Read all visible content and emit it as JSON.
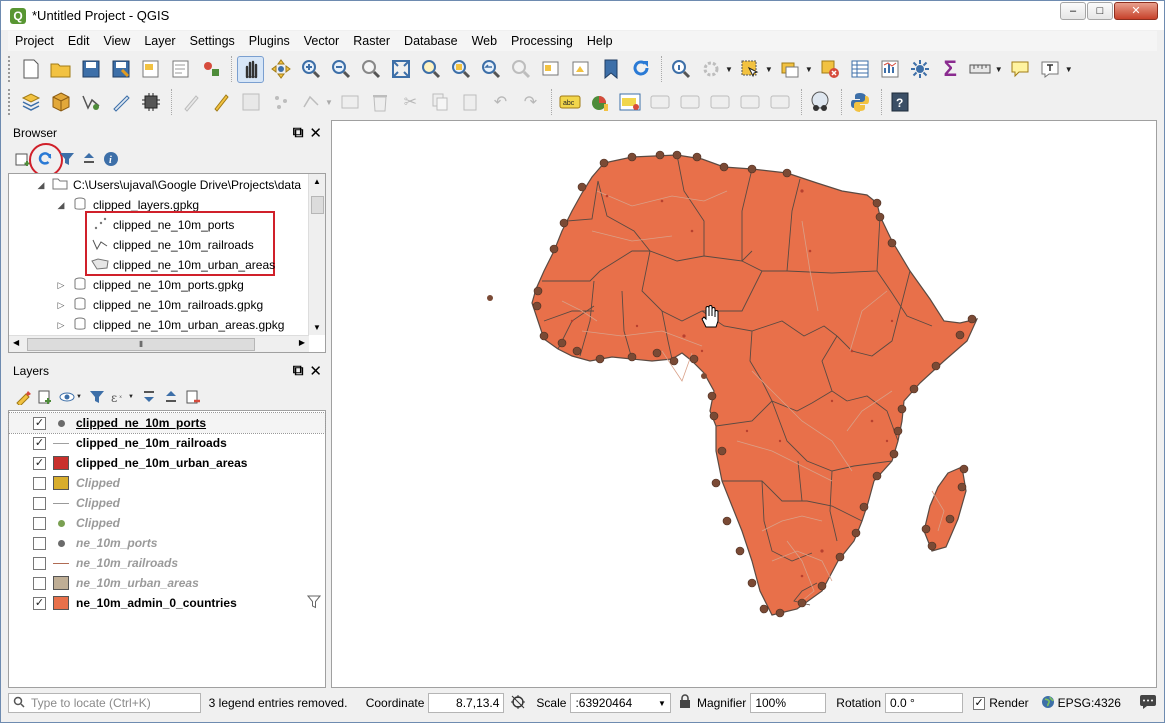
{
  "window": {
    "title": "*Untitled Project - QGIS",
    "minimize": "–",
    "maximize": "□",
    "close": "✕"
  },
  "menu": [
    "Project",
    "Edit",
    "View",
    "Layer",
    "Settings",
    "Plugins",
    "Vector",
    "Raster",
    "Database",
    "Web",
    "Processing",
    "Help"
  ],
  "browser": {
    "title": "Browser",
    "root_path": "C:\\Users\\ujaval\\Google Drive\\Projects\\data",
    "items": [
      {
        "label": "clipped_layers.gpkg",
        "type": "gpkg",
        "expanded": true
      },
      {
        "label": "clipped_ne_10m_ports",
        "type": "point"
      },
      {
        "label": "clipped_ne_10m_railroads",
        "type": "line"
      },
      {
        "label": "clipped_ne_10m_urban_areas",
        "type": "polygon"
      },
      {
        "label": "clipped_ne_10m_ports.gpkg",
        "type": "gpkg"
      },
      {
        "label": "clipped_ne_10m_railroads.gpkg",
        "type": "gpkg"
      },
      {
        "label": "clipped_ne_10m_urban_areas.gpkg",
        "type": "gpkg"
      }
    ]
  },
  "layers": {
    "title": "Layers",
    "items": [
      {
        "label": "clipped_ne_10m_ports",
        "checked": true,
        "symbol": "dot",
        "color": "#6b6b6b",
        "active": true
      },
      {
        "label": "clipped_ne_10m_railroads",
        "checked": true,
        "symbol": "line",
        "color": "#a0a0a0",
        "active": true
      },
      {
        "label": "clipped_ne_10m_urban_areas",
        "checked": true,
        "symbol": "fill",
        "color": "#c9302c",
        "active": true
      },
      {
        "label": "Clipped",
        "checked": false,
        "symbol": "fill",
        "color": "#d8ad2c",
        "active": false
      },
      {
        "label": "Clipped",
        "checked": false,
        "symbol": "line",
        "color": "#9a9a9a",
        "active": false
      },
      {
        "label": "Clipped",
        "checked": false,
        "symbol": "dot",
        "color": "#7aa052",
        "active": false
      },
      {
        "label": "ne_10m_ports",
        "checked": false,
        "symbol": "dot",
        "color": "#6b6b6b",
        "active": false
      },
      {
        "label": "ne_10m_railroads",
        "checked": false,
        "symbol": "line",
        "color": "#b06b53",
        "active": false
      },
      {
        "label": "ne_10m_urban_areas",
        "checked": false,
        "symbol": "fill",
        "color": "#bfae95",
        "active": false
      },
      {
        "label": "ne_10m_admin_0_countries",
        "checked": true,
        "symbol": "fill",
        "color": "#e8704a",
        "active": true
      }
    ]
  },
  "status": {
    "locator_placeholder": "Type to locate (Ctrl+K)",
    "message": "3 legend entries removed.",
    "coordinate_label": "Coordinate",
    "coordinate_value": "8.7,13.4",
    "scale_label": "Scale",
    "scale_value": ":63920464",
    "magnifier_label": "Magnifier",
    "magnifier_value": "100%",
    "rotation_label": "Rotation",
    "rotation_value": "0.0 °",
    "render_label": "Render",
    "crs": "EPSG:4326"
  },
  "colors": {
    "country_fill": "#e8704a",
    "border": "#5a4a42",
    "port": "#7a4a35",
    "rail": "#d9a088",
    "highlight": "#d0202a"
  }
}
